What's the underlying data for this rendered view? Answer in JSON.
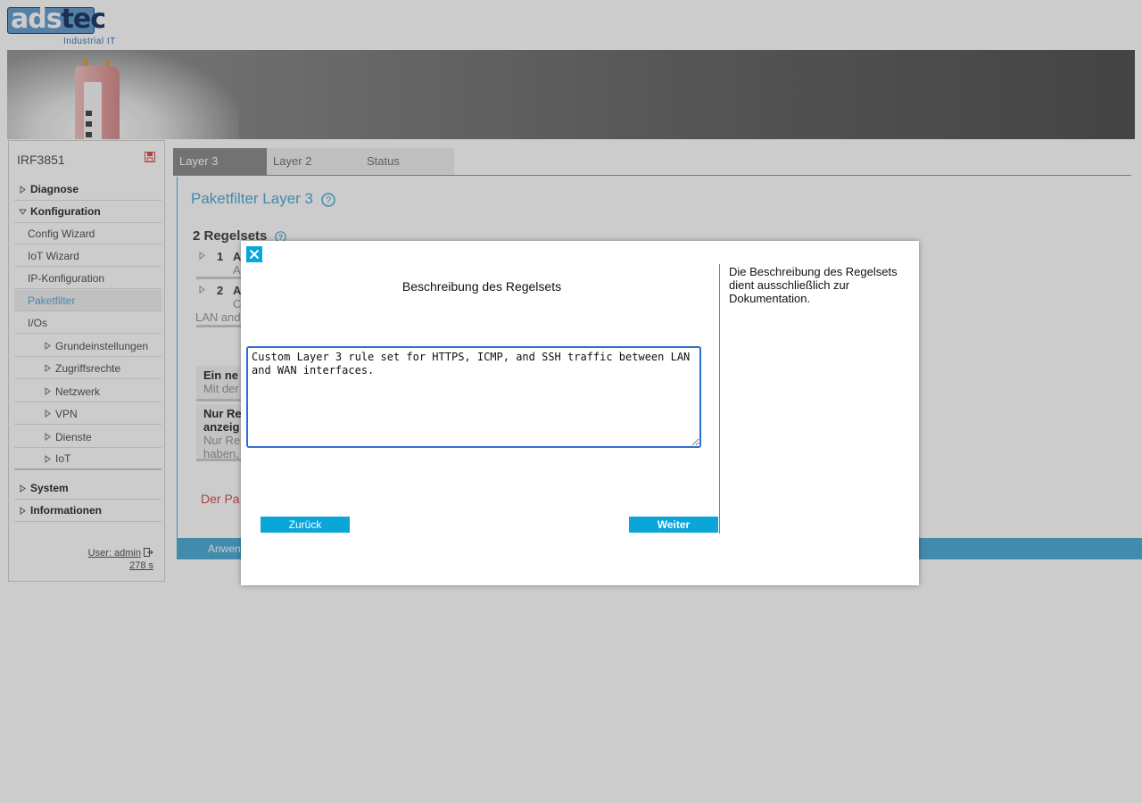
{
  "brand": {
    "logo_a": "ads",
    "logo_b": "tec",
    "tagline": "Industrial IT"
  },
  "device_name": "IRF3851",
  "sidebar": {
    "items": [
      {
        "label": "Diagnose"
      },
      {
        "label": "Konfiguration"
      },
      {
        "label": "Config Wizard"
      },
      {
        "label": "IoT Wizard"
      },
      {
        "label": "IP-Konfiguration"
      },
      {
        "label": "Paketfilter"
      },
      {
        "label": "I/Os"
      },
      {
        "label": "Grundeinstellungen"
      },
      {
        "label": "Zugriffsrechte"
      },
      {
        "label": "Netzwerk"
      },
      {
        "label": "VPN"
      },
      {
        "label": "Dienste"
      },
      {
        "label": "IoT"
      },
      {
        "label": "System"
      },
      {
        "label": "Informationen"
      }
    ],
    "user_label": "User: admin",
    "timer": "278 s"
  },
  "tabs": [
    {
      "label": "Layer 3"
    },
    {
      "label": "Layer 2"
    },
    {
      "label": "Status"
    }
  ],
  "main": {
    "title": "Paketfilter Layer 3",
    "section_title": "2 Regelsets",
    "rules": [
      {
        "num": "1",
        "head": "A",
        "sub": "A"
      },
      {
        "num": "2",
        "head": "A",
        "sub": "C",
        "sub2": "LAN and"
      }
    ],
    "box1_title": "Ein ne",
    "box1_text": "Mit der",
    "box2_title": "Nur Re",
    "box2_title2": "anzeig",
    "box2_text": "Nur Re",
    "box2_text2": "haben,",
    "error_text": "Der Pa",
    "apply_label": "Anwen"
  },
  "dialog": {
    "title": "Beschreibung des Regelsets",
    "description_value": "Custom Layer 3 rule set for HTTPS, ICMP, and SSH traffic between LAN and WAN interfaces.",
    "help_text": "Die Beschreibung des Regelsets dient ausschließlich zur Dokumentation.",
    "back_label": "Zurück",
    "next_label": "Weiter"
  },
  "colors": {
    "accent": "#0aa5d9",
    "menu_active": "#54aed8",
    "error": "#d9534f"
  }
}
